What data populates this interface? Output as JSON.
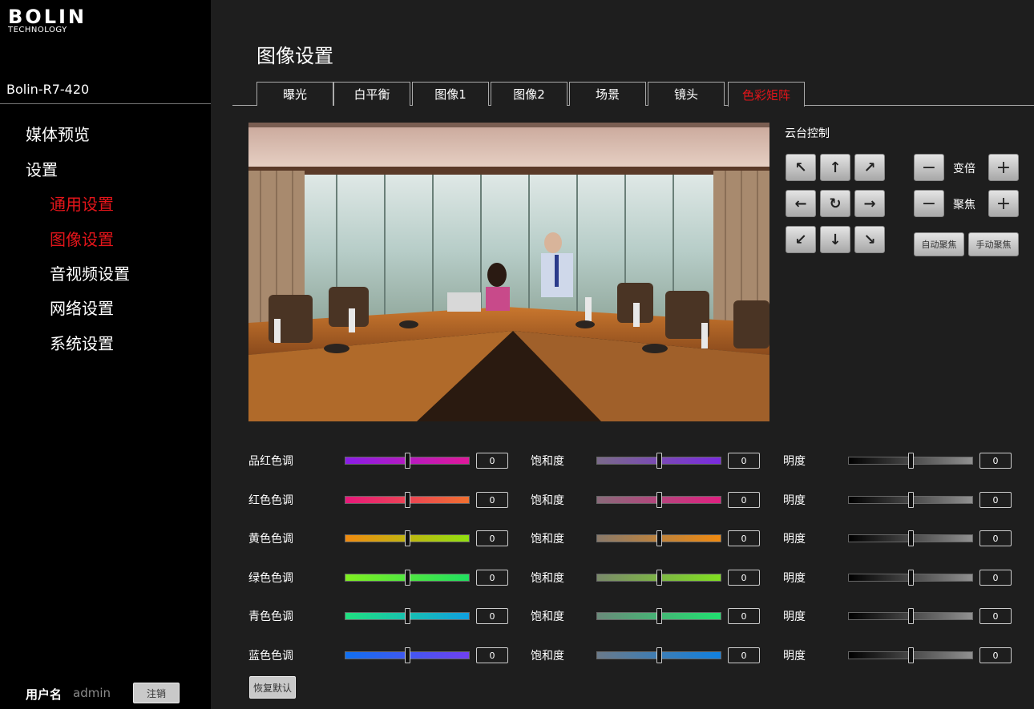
{
  "sidebar": {
    "logo": {
      "brand": "BOLIN",
      "sub": "TECHNOLOGY"
    },
    "device_name": "Bolin-R7-420",
    "nav": [
      {
        "label": "媒体预览",
        "active": false,
        "level": 1
      },
      {
        "label": "设置",
        "active": false,
        "level": 1
      },
      {
        "label": "通用设置",
        "active": true,
        "level": 2
      },
      {
        "label": "图像设置",
        "active": true,
        "level": 2
      },
      {
        "label": "音视频设置",
        "active": false,
        "level": 2
      },
      {
        "label": "网络设置",
        "active": false,
        "level": 2
      },
      {
        "label": "系统设置",
        "active": false,
        "level": 2
      }
    ],
    "user_label": "用户名",
    "user_name": "admin",
    "logout": "注销"
  },
  "main": {
    "title": "图像设置",
    "tabs": [
      {
        "label": "曝光",
        "active": false
      },
      {
        "label": "白平衡",
        "active": false
      },
      {
        "label": "图像1",
        "active": false
      },
      {
        "label": "图像2",
        "active": false
      },
      {
        "label": "场景",
        "active": false
      },
      {
        "label": "镜头",
        "active": false
      },
      {
        "label": "色彩矩阵",
        "active": true
      }
    ],
    "active_color": "#e3151a"
  },
  "ptz": {
    "title": "云台控制",
    "arrows": [
      "arrow-up-left-icon",
      "arrow-up-icon",
      "arrow-up-right-icon",
      "arrow-left-icon",
      "reset-rotate-icon",
      "arrow-right-icon",
      "arrow-down-left-icon",
      "arrow-down-icon",
      "arrow-down-right-icon"
    ],
    "arrow_glyphs": [
      "↖",
      "↑",
      "↗",
      "←",
      "↻",
      "→",
      "↙",
      "↓",
      "↘"
    ],
    "zoom_label": "变倍",
    "focus_label": "聚焦",
    "minus": "−",
    "plus": "+",
    "auto_focus": "自动聚焦",
    "manual_focus": "手动聚焦"
  },
  "color_matrix": {
    "rows": [
      {
        "hue_label": "品红色调",
        "hue_value": "0",
        "sat_label": "饱和度",
        "sat_value": "0",
        "lum_label": "明度",
        "lum_value": "0",
        "hue_gradient": [
          "#8a1de8",
          "#e0189a"
        ],
        "sat_gradient": [
          "#7a6a8a",
          "#7a2ae0"
        ],
        "level": 0.5
      },
      {
        "hue_label": "红色色调",
        "hue_value": "0",
        "sat_label": "饱和度",
        "sat_value": "0",
        "lum_label": "明度",
        "lum_value": "0",
        "hue_gradient": [
          "#e8187a",
          "#f07030"
        ],
        "sat_gradient": [
          "#8a6a7a",
          "#e02080"
        ],
        "level": 0.5
      },
      {
        "hue_label": "黄色色调",
        "hue_value": "0",
        "sat_label": "饱和度",
        "sat_value": "0",
        "lum_label": "明度",
        "lum_value": "0",
        "hue_gradient": [
          "#f08a10",
          "#90e010"
        ],
        "sat_gradient": [
          "#8a7a6a",
          "#f08a10"
        ],
        "level": 0.5
      },
      {
        "hue_label": "绿色色调",
        "hue_value": "0",
        "sat_label": "饱和度",
        "sat_value": "0",
        "lum_label": "明度",
        "lum_value": "0",
        "hue_gradient": [
          "#80f020",
          "#20e060"
        ],
        "sat_gradient": [
          "#7a8a6a",
          "#80e020"
        ],
        "level": 0.5
      },
      {
        "hue_label": "青色色调",
        "hue_value": "0",
        "sat_label": "饱和度",
        "sat_value": "0",
        "lum_label": "明度",
        "lum_value": "0",
        "hue_gradient": [
          "#20e080",
          "#10a0e0"
        ],
        "sat_gradient": [
          "#6a8a7a",
          "#20e070"
        ],
        "level": 0.5
      },
      {
        "hue_label": "蓝色色调",
        "hue_value": "0",
        "sat_label": "饱和度",
        "sat_value": "0",
        "lum_label": "明度",
        "lum_value": "0",
        "hue_gradient": [
          "#1070f0",
          "#7040f0"
        ],
        "sat_gradient": [
          "#6a7a8a",
          "#1080e0"
        ],
        "level": 0.5
      }
    ],
    "lum_gradient": [
      "#000000",
      "#909090"
    ],
    "reset": "恢复默认"
  }
}
